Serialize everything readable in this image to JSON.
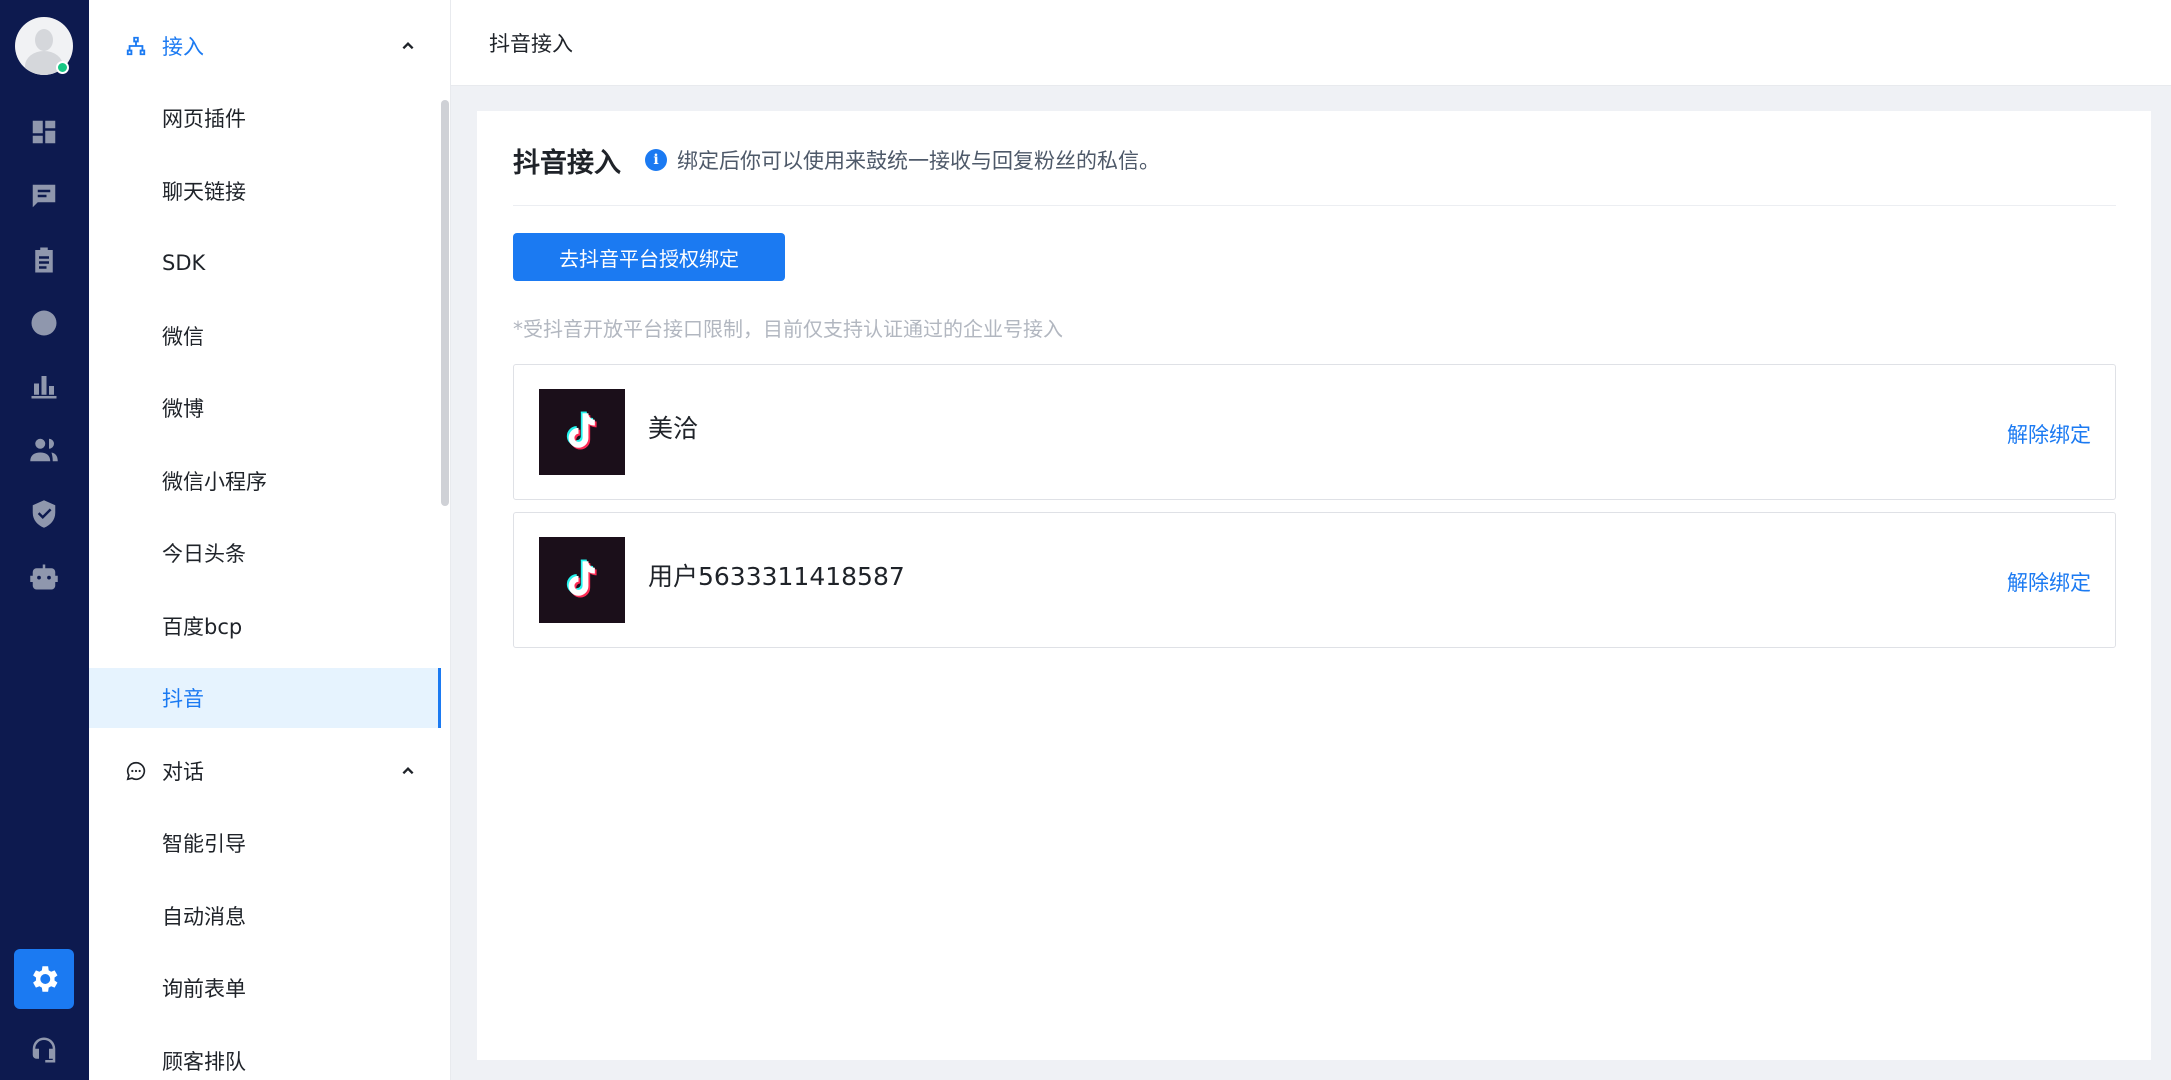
{
  "rail": {
    "icons": [
      "dashboard-icon",
      "chat-icon",
      "clipboard-icon",
      "clock-icon",
      "bar-chart-icon",
      "users-icon",
      "shield-icon",
      "robot-icon",
      "settings-icon",
      "support-icon"
    ],
    "active": "settings-icon",
    "accent": "#1b7af2",
    "background": "#0d1a4f"
  },
  "menu": {
    "group_access": {
      "label": "接入",
      "icon": "network-icon"
    },
    "access_items": [
      {
        "label": "网页插件"
      },
      {
        "label": "聊天链接"
      },
      {
        "label": "SDK"
      },
      {
        "label": "微信"
      },
      {
        "label": "微博"
      },
      {
        "label": "微信小程序"
      },
      {
        "label": "今日头条"
      },
      {
        "label": "百度bcp"
      },
      {
        "label": "抖音",
        "active": true
      }
    ],
    "group_dialog": {
      "label": "对话",
      "icon": "chat-bubble-icon"
    },
    "dialog_items": [
      {
        "label": "智能引导"
      },
      {
        "label": "自动消息"
      },
      {
        "label": "询前表单"
      },
      {
        "label": "顾客排队"
      }
    ]
  },
  "header": {
    "breadcrumb": "抖音接入"
  },
  "main": {
    "title": "抖音接入",
    "info_text": "绑定后你可以使用来鼓统一接收与回复粉丝的私信。",
    "bind_button": "去抖音平台授权绑定",
    "note": "*受抖音开放平台接口限制，目前仅支持认证通过的企业号接入",
    "accounts": [
      {
        "name": "美洽",
        "action": "解除绑定",
        "icon": "tiktok-logo"
      },
      {
        "name": "用户5633311418587",
        "action": "解除绑定",
        "icon": "tiktok-logo"
      }
    ]
  }
}
